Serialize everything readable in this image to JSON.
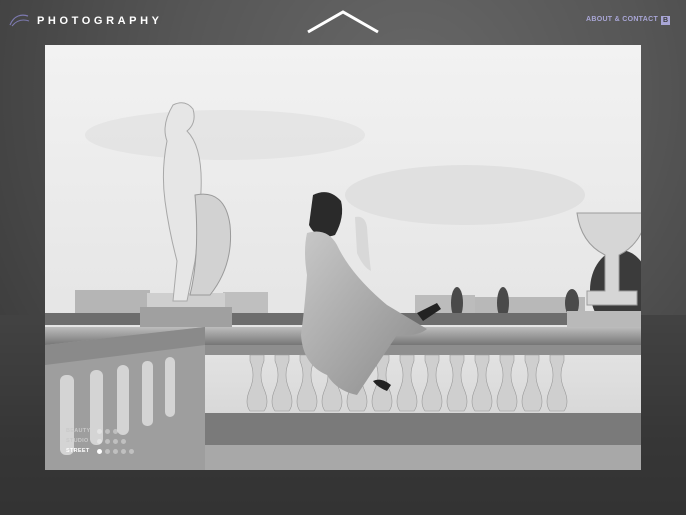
{
  "header": {
    "brand": "PHOTOGRAPHY",
    "about_link": "ABOUT & CONTACT",
    "social_icon": "B"
  },
  "icons": {
    "logo": "logo-icon",
    "home": "chevron-up-icon",
    "social": "blog-icon"
  },
  "colors": {
    "accent": "#a9a6d6",
    "text": "#ffffff",
    "overlay": "#3c3c3c"
  },
  "gallery": {
    "categories": [
      {
        "label": "BEAUTY",
        "dots": 3,
        "active_dot": -1,
        "active": false
      },
      {
        "label": "STUDIO",
        "dots": 4,
        "active_dot": -1,
        "active": false
      },
      {
        "label": "STREET",
        "dots": 5,
        "active_dot": 0,
        "active": true
      }
    ]
  }
}
